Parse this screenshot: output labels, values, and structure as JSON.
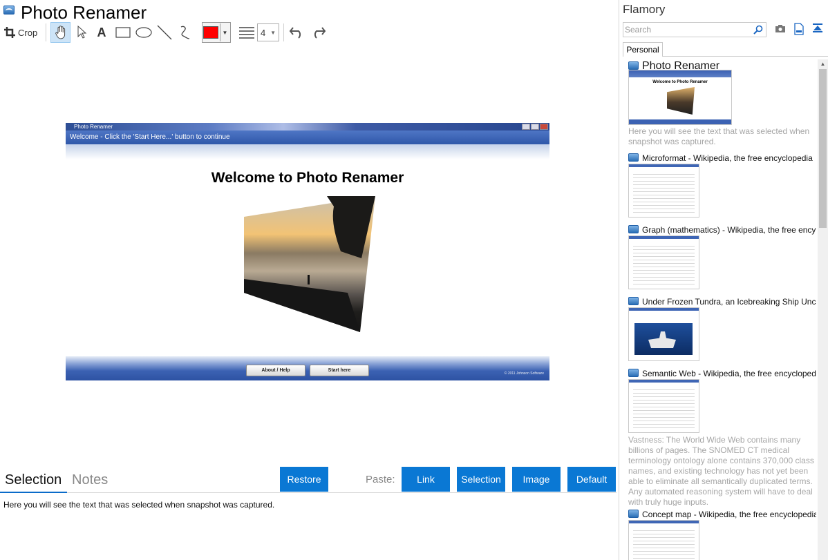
{
  "app": {
    "title": "Photo Renamer"
  },
  "toolbar": {
    "crop_label": "Crop",
    "text_tool_glyph": "A",
    "line_width_value": "4",
    "color_value": "#ff0000",
    "icons": [
      "crop-icon",
      "hand-icon",
      "arrow-icon",
      "rectangle-icon",
      "ellipse-icon",
      "line-icon",
      "freehand-icon",
      "line-weight-icon",
      "undo-icon",
      "redo-icon"
    ]
  },
  "screenshot": {
    "window_title": "Photo Renamer",
    "header_text": "Welcome - Click the 'Start Here...' button to continue",
    "welcome_heading": "Welcome to Photo Renamer",
    "about_button": "About / Help",
    "start_button": "Start here",
    "copyright": "© 2011 Johnson Software"
  },
  "bottom": {
    "tabs": {
      "selection": "Selection",
      "notes": "Notes"
    },
    "restore_label": "Restore",
    "paste_label": "Paste:",
    "paste_buttons": {
      "link": "Link",
      "selection": "Selection",
      "image": "Image",
      "default": "Default"
    },
    "selection_text": "Here you will see the text that was selected when snapshot was captured."
  },
  "sidebar": {
    "app_name": "Flamory",
    "search_placeholder": "Search",
    "tab_label": "Personal",
    "items": [
      {
        "title": "Photo Renamer",
        "description": "Here you will see the text that was selected when snapshot was captured."
      },
      {
        "title": "Microformat - Wikipedia, the free encyclopedia"
      },
      {
        "title": "Graph (mathematics) - Wikipedia, the free ency"
      },
      {
        "title": "Under Frozen Tundra, an Icebreaking Ship Unco"
      },
      {
        "title": "Semantic Web - Wikipedia, the free encycloped",
        "description": "Vastness: The World Wide Web contains many billions of pages. The SNOMED CT medical terminology ontology alone contains 370,000 class names, and existing technology has not yet been able to eliminate all semantically duplicated terms. Any automated reasoning system will have to deal with truly huge inputs."
      },
      {
        "title": "Concept map - Wikipedia, the free encyclopedia"
      }
    ]
  },
  "colors": {
    "accent": "#0a78d4",
    "tab_underline": "#0a6bc9",
    "selected_tool_bg": "#cde4f7"
  }
}
